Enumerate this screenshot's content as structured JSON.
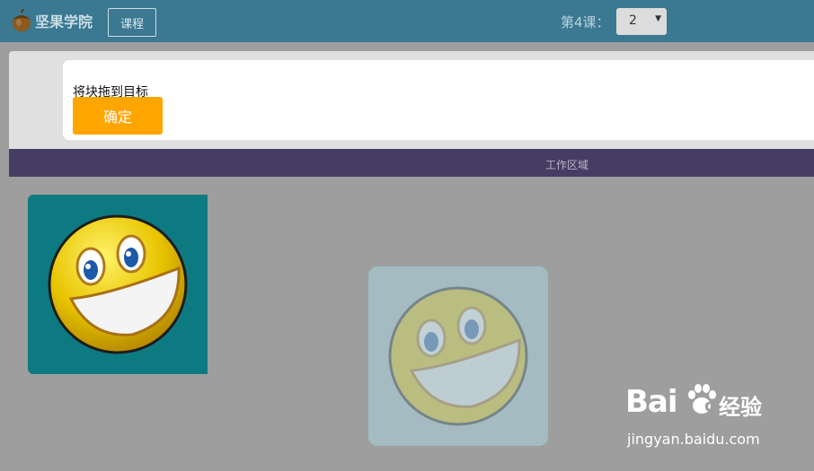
{
  "header": {
    "logo_text": "坚果学院",
    "course_button": "课程",
    "lesson_label": "第4课：",
    "lesson_select_value": "2"
  },
  "instructions": {
    "text": "将块拖到目标",
    "confirm_button": "确定"
  },
  "workspace": {
    "title": "工作区域"
  },
  "watermark": {
    "brand": "Bai",
    "brand_suffix": "du",
    "product": "经验",
    "url": "jingyan.baidu.com"
  },
  "colors": {
    "topbar": "#3b7891",
    "confirm": "#ffa500",
    "work_header": "#473c63",
    "drag_block": "#0d7a82",
    "drop_target": "#a5bdc4"
  },
  "icons": {
    "logo": "acorn-icon",
    "select": "caret-down-icon",
    "block": "smiley-face-icon"
  }
}
